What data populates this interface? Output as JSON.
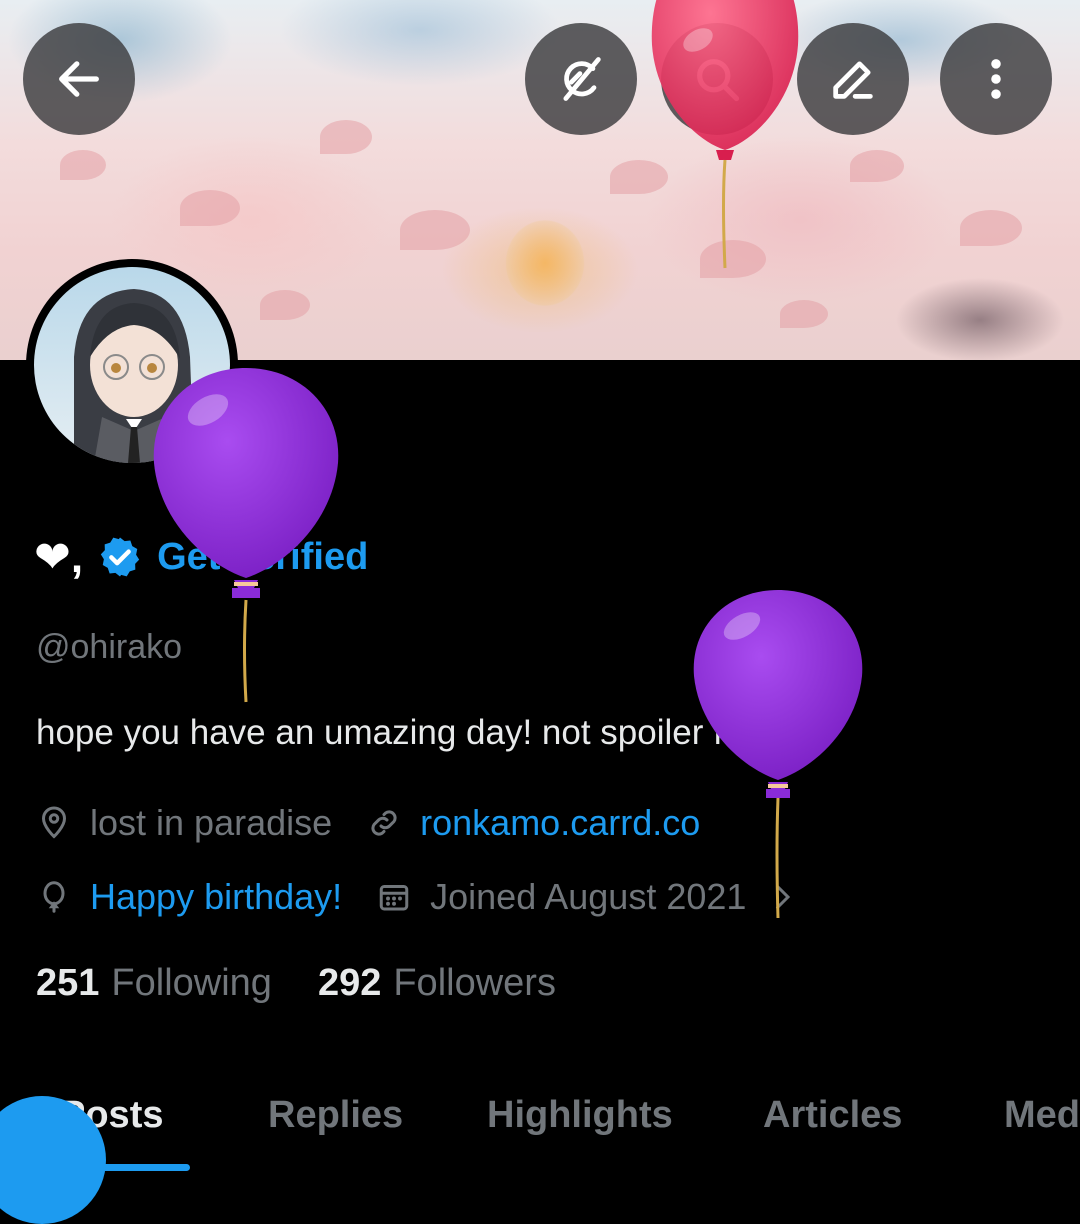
{
  "colors": {
    "accent": "#1d9bf0",
    "muted": "#71767b",
    "text": "#e7e9ea",
    "background": "#000000"
  },
  "header": {
    "buttons": [
      {
        "name": "back-button",
        "icon": "arrow-left-icon"
      },
      {
        "name": "grok-button",
        "icon": "grok-icon"
      },
      {
        "name": "search-button",
        "icon": "search-icon"
      },
      {
        "name": "edit-button",
        "icon": "pencil-icon"
      },
      {
        "name": "more-button",
        "icon": "more-vertical-icon"
      }
    ]
  },
  "profile": {
    "display_name": "❤,",
    "verified_badge_icon": "verified-badge-icon",
    "get_verified_label": "Get Verified",
    "handle": "@ohirako",
    "bio": "hope you have an umazing day! not spoiler free",
    "location": "lost in paradise",
    "website": "ronkamo.carrd.co",
    "birthday": "Happy birthday!",
    "joined": "Joined August 2021",
    "following_count": "251",
    "following_label": "Following",
    "followers_count": "292",
    "followers_label": "Followers"
  },
  "tabs": [
    {
      "label": "Posts",
      "active": true
    },
    {
      "label": "Replies",
      "active": false
    },
    {
      "label": "Highlights",
      "active": false
    },
    {
      "label": "Articles",
      "active": false
    },
    {
      "label": "Media",
      "active": false
    }
  ],
  "decorations": {
    "balloon_colors": [
      "#e8365e",
      "#8a2bd8",
      "#8a2bd8"
    ]
  }
}
